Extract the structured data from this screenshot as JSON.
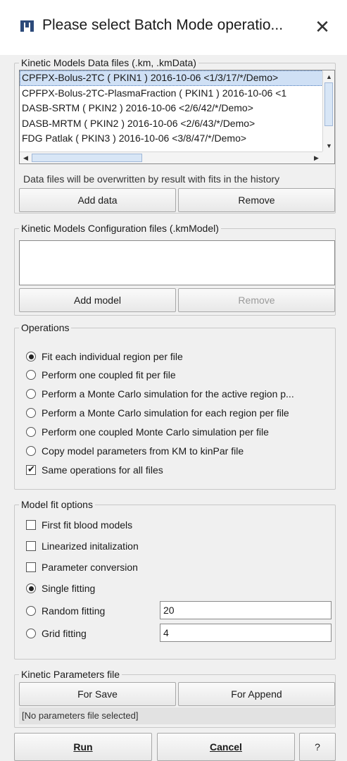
{
  "window": {
    "title": "Please select Batch Mode operatio...",
    "close_glyph": "✕",
    "app_icon": "pmod-app-icon"
  },
  "data_files": {
    "legend": "Kinetic Models Data files (.km, .kmData)",
    "items": [
      "CPFPX-Bolus-2TC ( PKIN1 ) 2016-10-06 <1/3/17/*/Demo>",
      "CPFPX-Bolus-2TC-PlasmaFraction ( PKIN1 ) 2016-10-06 <1",
      "DASB-SRTM ( PKIN2 ) 2016-10-06 <2/6/42/*/Demo>",
      "DASB-MRTM ( PKIN2 ) 2016-10-06 <2/6/43/*/Demo>",
      "FDG Patlak ( PKIN3 ) 2016-10-06 <3/8/47/*/Demo>"
    ],
    "note": "Data files will be overwritten by result with fits in the history",
    "add_label": "Add data",
    "remove_label": "Remove"
  },
  "config_files": {
    "legend": "Kinetic Models Configuration files (.kmModel)",
    "add_label": "Add model",
    "remove_label": "Remove"
  },
  "operations": {
    "legend": "Operations",
    "options": [
      "Fit each individual region per file",
      "Perform one coupled fit per file",
      "Perform a Monte Carlo simulation for the active region p...",
      "Perform a Monte Carlo simulation for each region per file",
      "Perform one coupled Monte Carlo simulation per file",
      "Copy model parameters from KM to kinPar file"
    ],
    "selected_index": 0,
    "same_ops_label": "Same operations for all files",
    "same_ops_checked": true
  },
  "fit_options": {
    "legend": "Model fit options",
    "first_fit_label": "First fit blood models",
    "linearized_label": "Linearized initalization",
    "param_conv_label": "Parameter conversion",
    "single_label": "Single fitting",
    "random_label": "Random fitting",
    "random_value": "20",
    "grid_label": "Grid fitting",
    "grid_value": "4",
    "selected": "single"
  },
  "kinetic_params": {
    "legend": "Kinetic Parameters file",
    "save_label": "For Save",
    "append_label": "For Append",
    "status": "[No parameters file selected]"
  },
  "footer": {
    "run_label": "Run",
    "cancel_label": "Cancel",
    "help_label": "?"
  },
  "colors": {
    "selection": "#cfe0f5",
    "background": "#f0f0f0"
  }
}
